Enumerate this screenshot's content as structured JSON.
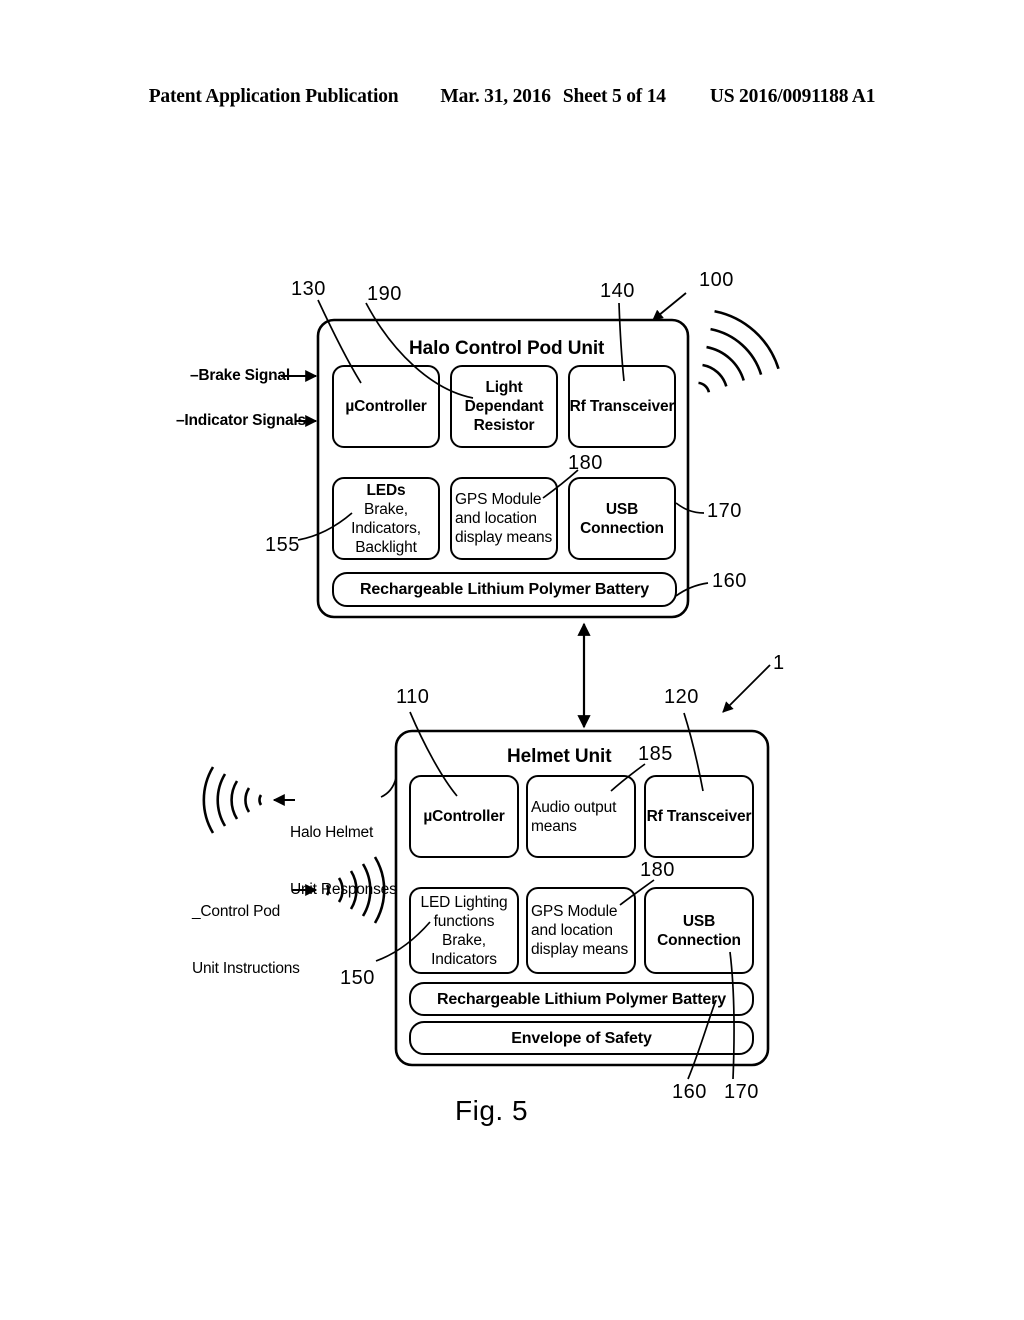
{
  "header": {
    "publication": "Patent Application Publication",
    "date": "Mar. 31, 2016",
    "sheet": "Sheet 5 of 14",
    "number": "US 2016/0091188 A1"
  },
  "figure": {
    "caption": "Fig. 5",
    "control_pod": {
      "title": "Halo Control Pod Unit",
      "ref": "100",
      "blocks": [
        {
          "id": "ucontroller",
          "ref": "130",
          "lines": [
            "µController"
          ],
          "bold": true,
          "align": "center"
        },
        {
          "id": "ldr",
          "ref": "190",
          "lines": [
            "Light",
            "Dependant",
            "Resistor"
          ],
          "bold": true,
          "align": "center"
        },
        {
          "id": "rf",
          "ref": "140",
          "lines": [
            "Rf Transceiver"
          ],
          "bold": true,
          "align": "center"
        },
        {
          "id": "leds",
          "ref": "155",
          "lines": [
            "LEDs",
            "Brake,",
            "Indicators,",
            "Backlight"
          ],
          "bold": true,
          "align": "center"
        },
        {
          "id": "gps",
          "ref": "180",
          "lines": [
            "GPS Module",
            "and location",
            "display means"
          ],
          "bold": false,
          "align": "left"
        },
        {
          "id": "usb",
          "ref": "170",
          "lines": [
            "USB",
            "Connection"
          ],
          "bold": true,
          "align": "center"
        },
        {
          "id": "battery",
          "ref": "160",
          "lines": [
            "Rechargeable Lithium Polymer Battery"
          ],
          "bold": true,
          "align": "center"
        }
      ],
      "inputs": [
        {
          "id": "brake-signal",
          "label": "–Brake Signal"
        },
        {
          "id": "indicator-signals",
          "label": "–Indicator Signals"
        }
      ]
    },
    "helmet_unit": {
      "title": "Helmet Unit",
      "ref": "1",
      "blocks": [
        {
          "id": "ucontroller",
          "ref": "110",
          "lines": [
            "µController"
          ],
          "bold": true,
          "align": "center"
        },
        {
          "id": "audio",
          "ref": "185",
          "lines": [
            "Audio output",
            "means"
          ],
          "bold": false,
          "align": "left"
        },
        {
          "id": "rf",
          "ref": "120",
          "lines": [
            "Rf Transceiver"
          ],
          "bold": true,
          "align": "center"
        },
        {
          "id": "led-lighting",
          "ref": "150",
          "lines": [
            "LED Lighting",
            "functions",
            "Brake,",
            "Indicators"
          ],
          "bold": false,
          "align": "center"
        },
        {
          "id": "gps",
          "ref": "180",
          "lines": [
            "GPS Module",
            "and location",
            "display means"
          ],
          "bold": false,
          "align": "left"
        },
        {
          "id": "usb",
          "ref": "170",
          "lines": [
            "USB",
            "Connection"
          ],
          "bold": true,
          "align": "center"
        },
        {
          "id": "battery",
          "ref": "160",
          "lines": [
            "Rechargeable Lithium Polymer Battery"
          ],
          "bold": true,
          "align": "center"
        },
        {
          "id": "envelope",
          "ref": "",
          "lines": [
            "Envelope of Safety"
          ],
          "bold": true,
          "align": "center"
        }
      ],
      "signals": [
        {
          "id": "helmet-responses",
          "lines": [
            "Halo Helmet",
            "Unit Responses"
          ],
          "direction": "out"
        },
        {
          "id": "pod-instructions",
          "lines": [
            "_Control Pod",
            "Unit Instructions"
          ],
          "direction": "in"
        }
      ],
      "bottom_refs": [
        "160",
        "170"
      ]
    }
  },
  "colors": {
    "ink": "#000000",
    "paper": "#ffffff"
  }
}
